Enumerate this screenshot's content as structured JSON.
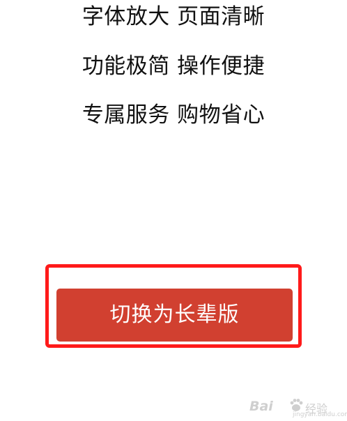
{
  "features": [
    "字体放大 页面清晰",
    "功能极简 操作便捷",
    "专属服务 购物省心"
  ],
  "switch_button": {
    "label": "切换为长辈版",
    "bg_color": "#d14030",
    "text_color": "#ffffff"
  },
  "highlight_box": {
    "color": "#ff1a1a"
  },
  "watermark": {
    "brand": "Bai",
    "brand_suffix": "经验",
    "url": "jingyan.baidu.com"
  }
}
